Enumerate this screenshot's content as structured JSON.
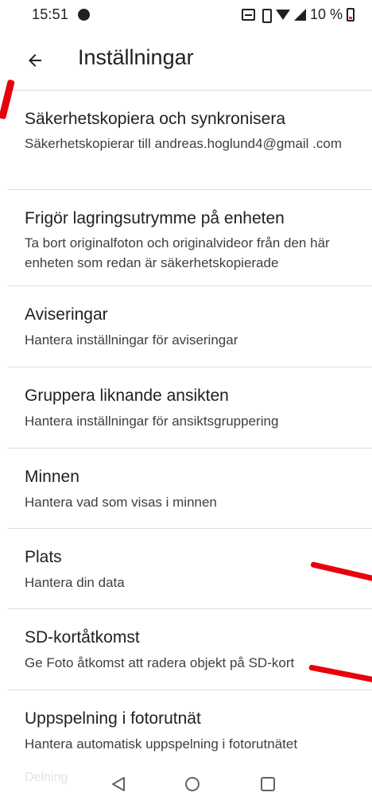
{
  "status_bar": {
    "time": "15:51",
    "battery_text": "10 %",
    "icons": [
      "dnd-icon",
      "volte-icon",
      "vibrate-icon",
      "wifi-icon",
      "signal-icon",
      "battery-icon"
    ],
    "battery_color": "#e53935"
  },
  "app_bar": {
    "back_icon": "arrow-back-icon",
    "title": "Inställningar"
  },
  "settings": [
    {
      "title": "Säkerhetskopiera och synkronisera",
      "subtitle": "Säkerhetskopierar till andreas.hoglund4@gmail .com"
    },
    {
      "title": "Frigör lagringsutrymme på enheten",
      "subtitle": "Ta bort originalfoton och originalvideor från den här enheten som redan är säkerhetskopierade"
    },
    {
      "title": "Aviseringar",
      "subtitle": "Hantera inställningar för aviseringar"
    },
    {
      "title": "Gruppera liknande ansikten",
      "subtitle": "Hantera inställningar för ansiktsgruppering"
    },
    {
      "title": "Minnen",
      "subtitle": "Hantera vad som visas i minnen"
    },
    {
      "title": "Plats",
      "subtitle": "Hantera din data"
    },
    {
      "title": "SD-kortåtkomst",
      "subtitle": "Ge Foto åtkomst att radera objekt på SD-kort"
    },
    {
      "title": "Uppspelning i fotorutnät",
      "subtitle": "Hantera automatisk uppspelning i fotorutnätet"
    }
  ],
  "nav_bar": {
    "faded_label": "Delning",
    "buttons": [
      "back-triangle-icon",
      "home-circle-icon",
      "recents-square-icon"
    ]
  },
  "colors": {
    "annotation": "#e8000b",
    "divider": "#dadce0",
    "text_primary": "#202124",
    "text_secondary": "#3c4043"
  }
}
